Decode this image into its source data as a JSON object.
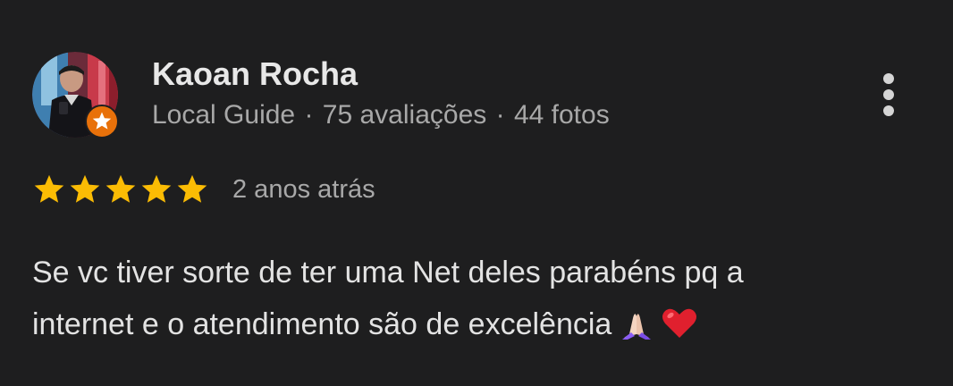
{
  "reviewer": {
    "name": "Kaoan Rocha",
    "badge": "Local Guide",
    "separator": "·",
    "reviews_count": "75 avaliações",
    "photos_count": "44 fotos",
    "avatar_icon": "profile-photo",
    "badge_icon": "local-guide-star-icon"
  },
  "rating": {
    "stars": 5,
    "max_stars": 5,
    "star_color": "#fbbc04",
    "date": "2 anos atrás"
  },
  "review": {
    "line1": "Se vc tiver sorte de ter uma Net deles parabéns pq a",
    "line2": "internet e o atendimento são de excelência",
    "emojis": [
      "folded-hands-icon",
      "red-heart-icon"
    ]
  },
  "menu": {
    "icon": "more-vert-icon"
  },
  "colors": {
    "background": "#1e1e1f",
    "primary_text": "#e3e3e3",
    "secondary_text": "#a8a8a8",
    "badge_orange": "#e8710a"
  }
}
